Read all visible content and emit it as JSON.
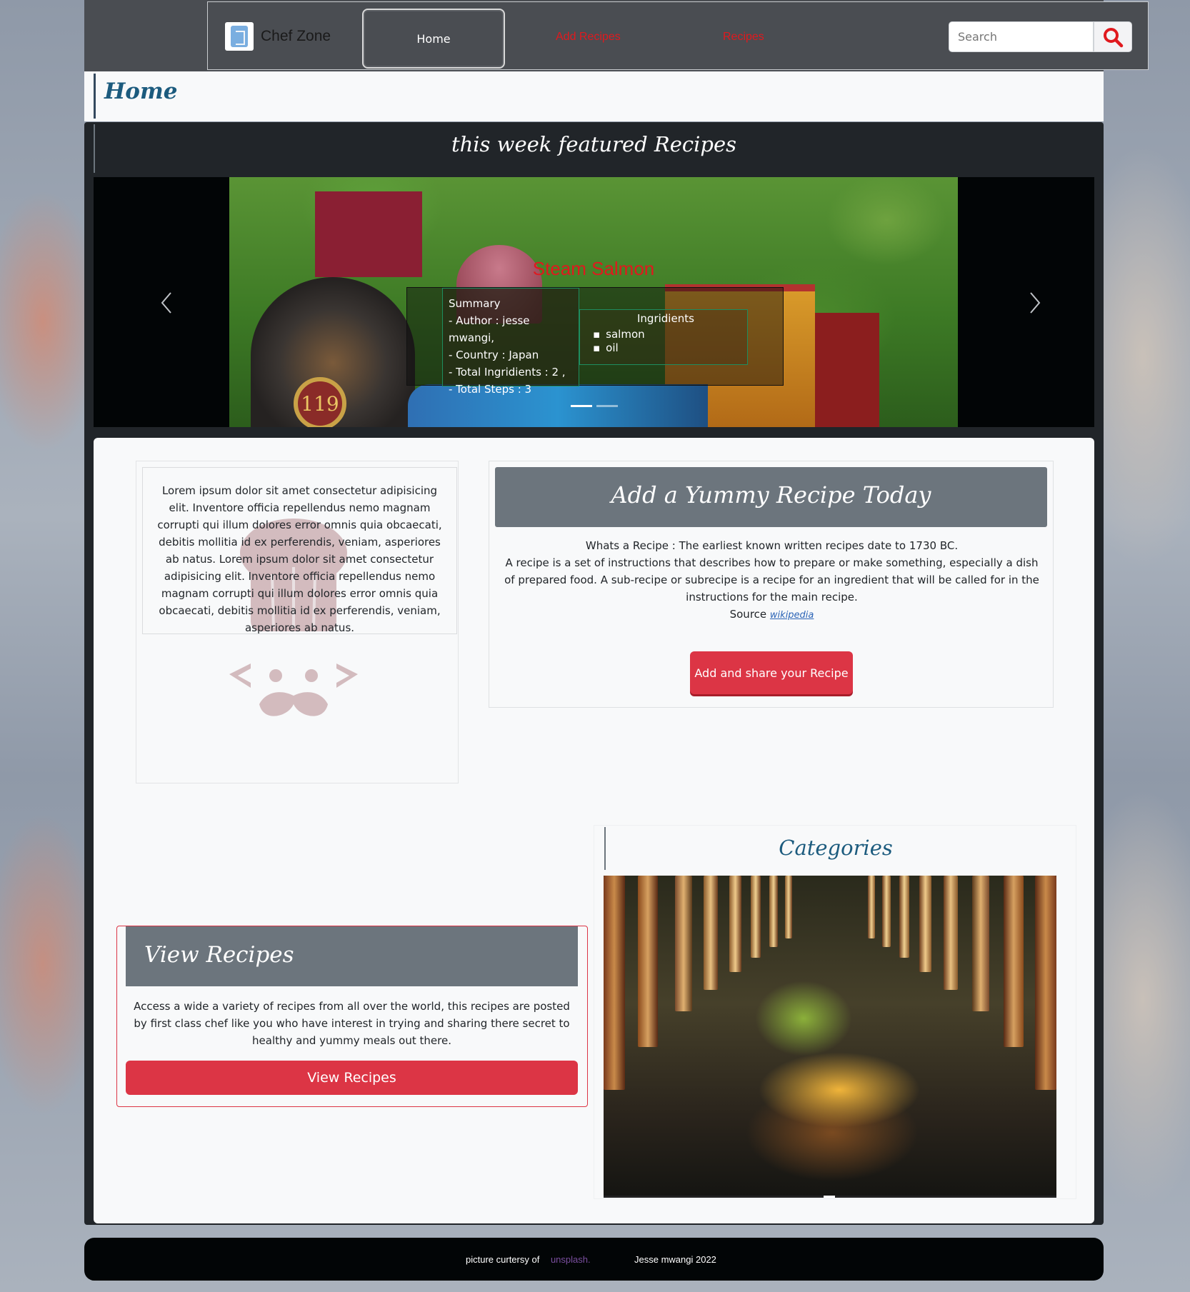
{
  "navbar": {
    "brand": "Chef Zone",
    "home": "Home",
    "add_recipes": "Add Recipes",
    "recipes": "Recipes",
    "search_placeholder": "Search",
    "accent_color": "#e0191e"
  },
  "home_header": {
    "title": "Home"
  },
  "featured": {
    "title": "this week featured Recipes",
    "slide": {
      "recipe_name": "Steam Salmon",
      "summary_title": "Summary",
      "summary_lines": [
        "- Author : jesse mwangi,",
        "- Country : Japan",
        "- Total Ingridients : 2 ,",
        "- Total Steps : 3"
      ],
      "ingredients_title": "Ingridients",
      "ingredients": [
        "salmon",
        "oil"
      ]
    },
    "slide_count": 2,
    "active_slide": 1
  },
  "intro_card": {
    "text": "Lorem ipsum dolor sit amet consectetur adipisicing elit. Inventore officia repellendus nemo magnam corrupti qui illum dolores error omnis quia obcaecati, debitis mollitia id ex perferendis, veniam, asperiores ab natus. Lorem ipsum dolor sit amet consectetur adipisicing elit. Inventore officia repellendus nemo magnam corrupti qui illum dolores error omnis quia obcaecati, debitis mollitia id ex perferendis, veniam, asperiores ab natus."
  },
  "add_recipe_card": {
    "title": "Add a Yummy Recipe Today",
    "line1": "Whats a Recipe : The earliest known written recipes date to 1730 BC.",
    "line2": "A recipe is a set of instructions that describes how to prepare or make something, especially a dish of prepared food. A sub-recipe or subrecipe is a recipe for an ingredient that will be called for in the instructions for the main recipe.",
    "source_label": "Source",
    "source_link": "wikipedia",
    "button": "Add and share your Recipe"
  },
  "view_recipes_card": {
    "title": "View Recipes",
    "text": "Access a wide a variety of recipes from all over the world, this recipes are posted by first class chef like you who have interest in trying and sharing there secret to healthy and yummy meals out there.",
    "button": "View Recipes"
  },
  "categories_card": {
    "title": "Categories"
  },
  "footer": {
    "credit": "picture curtersy of",
    "credit_link": "unsplash.",
    "author": "Jesse mwangi 2022"
  },
  "colors": {
    "primary_red": "#dc3545",
    "header_gray": "#6c757d",
    "dark_bg": "#212529",
    "heading_blue": "#1c5b7e"
  }
}
